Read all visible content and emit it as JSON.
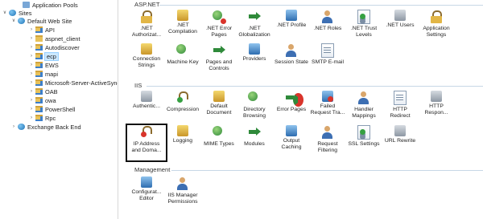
{
  "tree": {
    "items": [
      {
        "label": "Application Pools",
        "icon": "app-pool-icon"
      },
      {
        "label": "Sites",
        "icon": "globe-icon",
        "twisty": "v"
      },
      {
        "label": "Default Web Site",
        "icon": "globe-icon",
        "twisty": "v"
      },
      {
        "label": "API",
        "icon": "folder-app-icon",
        "twisty": ">"
      },
      {
        "label": "aspnet_client",
        "icon": "folder-icon",
        "twisty": ">"
      },
      {
        "label": "Autodiscover",
        "icon": "folder-app-icon",
        "twisty": ">"
      },
      {
        "label": "ecp",
        "icon": "folder-app-icon",
        "twisty": ">",
        "selected": true
      },
      {
        "label": "EWS",
        "icon": "folder-app-icon",
        "twisty": ">"
      },
      {
        "label": "mapi",
        "icon": "folder-app-icon",
        "twisty": ">"
      },
      {
        "label": "Microsoft-Server-ActiveSync",
        "icon": "folder-app-icon",
        "twisty": ">"
      },
      {
        "label": "OAB",
        "icon": "folder-app-icon",
        "twisty": ">"
      },
      {
        "label": "owa",
        "icon": "folder-app-icon",
        "twisty": ">"
      },
      {
        "label": "PowerShell",
        "icon": "folder-app-icon",
        "twisty": ">"
      },
      {
        "label": "Rpc",
        "icon": "folder-app-icon",
        "twisty": ">"
      },
      {
        "label": "Exchange Back End",
        "icon": "globe-icon",
        "twisty": ">"
      }
    ]
  },
  "sections": {
    "aspnet": {
      "title": "ASP.NET",
      "tiles": [
        {
          "label": ".NET\nAuthorizat...",
          "icon": "net-authorization-icon"
        },
        {
          "label": ".NET\nCompilation",
          "icon": "net-compilation-icon"
        },
        {
          "label": ".NET Error\nPages",
          "icon": "net-error-pages-icon"
        },
        {
          "label": ".NET\nGlobalization",
          "icon": "net-globalization-icon"
        },
        {
          "label": ".NET Profile",
          "icon": "net-profile-icon"
        },
        {
          "label": ".NET Roles",
          "icon": "net-roles-icon"
        },
        {
          "label": ".NET Trust\nLevels",
          "icon": "net-trust-levels-icon"
        },
        {
          "label": ".NET Users",
          "icon": "net-users-icon"
        },
        {
          "label": "Application\nSettings",
          "icon": "application-settings-icon"
        },
        {
          "label": "Connection\nStrings",
          "icon": "connection-strings-icon"
        },
        {
          "label": "Machine Key",
          "icon": "machine-key-icon"
        },
        {
          "label": "Pages and\nControls",
          "icon": "pages-and-controls-icon"
        },
        {
          "label": "Providers",
          "icon": "providers-icon"
        },
        {
          "label": "Session State",
          "icon": "session-state-icon"
        },
        {
          "label": "SMTP E-mail",
          "icon": "smtp-email-icon"
        }
      ]
    },
    "iis": {
      "title": "IIS",
      "tiles": [
        {
          "label": "Authentic...",
          "icon": "authentication-icon"
        },
        {
          "label": "Compression",
          "icon": "compression-icon"
        },
        {
          "label": "Default\nDocument",
          "icon": "default-document-icon"
        },
        {
          "label": "Directory\nBrowsing",
          "icon": "directory-browsing-icon"
        },
        {
          "label": "Error Pages",
          "icon": "error-pages-icon"
        },
        {
          "label": "Failed\nRequest Tra...",
          "icon": "failed-request-tracing-icon"
        },
        {
          "label": "Handler\nMappings",
          "icon": "handler-mappings-icon"
        },
        {
          "label": "HTTP\nRedirect",
          "icon": "http-redirect-icon"
        },
        {
          "label": "HTTP\nRespon...",
          "icon": "http-response-headers-icon"
        },
        {
          "label": "IP Address\nand Doma...",
          "icon": "ip-address-domain-icon",
          "highlighted": true
        },
        {
          "label": "Logging",
          "icon": "logging-icon"
        },
        {
          "label": "MIME Types",
          "icon": "mime-types-icon"
        },
        {
          "label": "Modules",
          "icon": "modules-icon"
        },
        {
          "label": "Output\nCaching",
          "icon": "output-caching-icon"
        },
        {
          "label": "Request\nFiltering",
          "icon": "request-filtering-icon"
        },
        {
          "label": "SSL Settings",
          "icon": "ssl-settings-icon"
        },
        {
          "label": "URL Rewrite",
          "icon": "url-rewrite-icon"
        }
      ]
    },
    "management": {
      "title": "Management",
      "tiles": [
        {
          "label": "Configurat...\nEditor",
          "icon": "configuration-editor-icon"
        },
        {
          "label": "IIS Manager\nPermissions",
          "icon": "iis-manager-permissions-icon"
        }
      ]
    }
  }
}
